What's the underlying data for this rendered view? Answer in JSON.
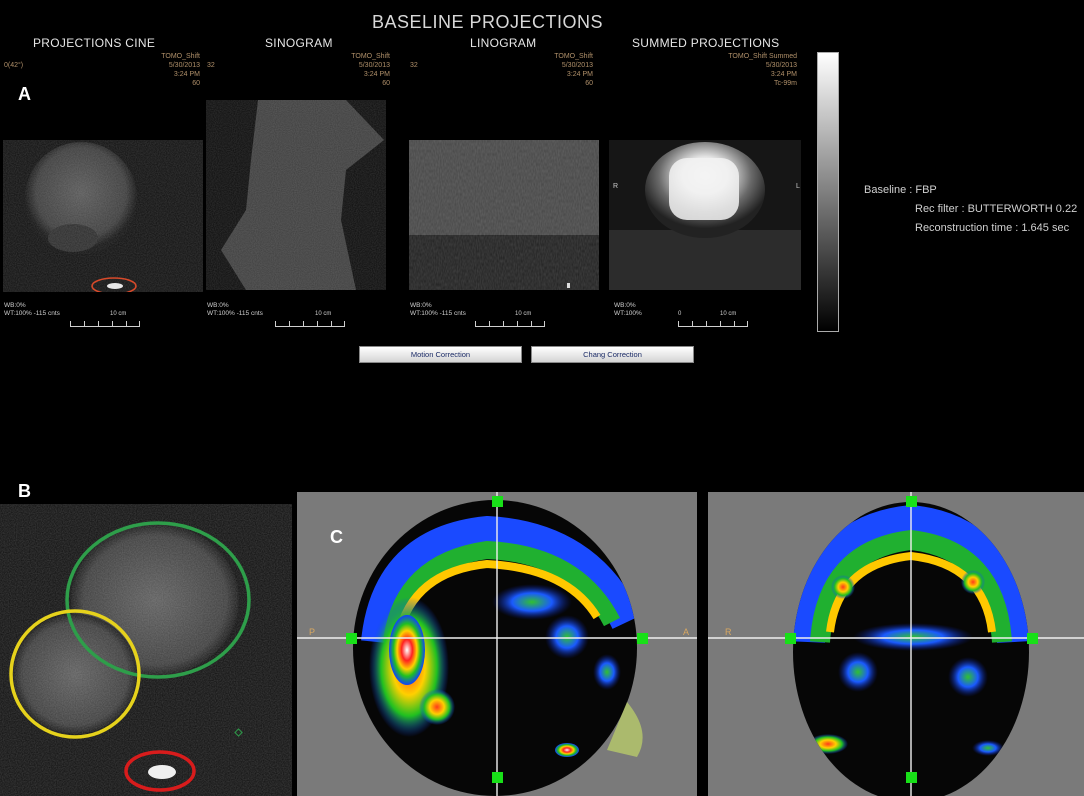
{
  "header": {
    "title": "BASELINE PROJECTIONS"
  },
  "panel_labels": {
    "a": "A",
    "b": "B",
    "c": "C"
  },
  "panels": [
    {
      "title": "PROJECTIONS CINE",
      "meta_left": "0(42°)",
      "meta": [
        "TOMO_Shift",
        "5/30/2013",
        "3:24 PM",
        "60"
      ],
      "foot": [
        "WB:0%",
        "WT:100% -115 cnts"
      ],
      "ruler_label": "10 cm"
    },
    {
      "title": "SINOGRAM",
      "meta_left": "32",
      "meta": [
        "TOMO_Shift",
        "5/30/2013",
        "3:24 PM",
        "60"
      ],
      "foot": [
        "WB:0%",
        "WT:100% -115 cnts"
      ],
      "ruler_label": "10 cm"
    },
    {
      "title": "LINOGRAM",
      "meta_left": "32",
      "meta": [
        "TOMO_Shift",
        "5/30/2013",
        "3:24 PM",
        "60"
      ],
      "foot": [
        "WB:0%",
        "WT:100% -115 cnts"
      ],
      "ruler_label": "10 cm"
    },
    {
      "title": "SUMMED PROJECTIONS",
      "meta_left": "",
      "meta": [
        "TOMO_Shift Summed",
        "5/30/2013",
        "3:24 PM",
        "Tc-99m"
      ],
      "foot": [
        "WB:0%",
        "WT:100%"
      ],
      "ruler_label": "10 cm",
      "ruler_zero": "0",
      "side_left": "R",
      "side_right": "L"
    }
  ],
  "reconstruction": {
    "line1": "Baseline : FBP",
    "line2": "Rec filter : BUTTERWORTH 0.22",
    "line3": "Reconstruction time : 1.645 sec"
  },
  "buttons": {
    "motion": "Motion Correction",
    "chang": "Chang Correction"
  },
  "orientation": {
    "posterior": "P",
    "anterior": "A",
    "right": "R"
  },
  "colors": {
    "roi_green": "#2e9e4a",
    "roi_yellow": "#e6d21c",
    "roi_red": "#d81c1c",
    "marker": "#18e018",
    "meta_text": "#b0906a"
  }
}
